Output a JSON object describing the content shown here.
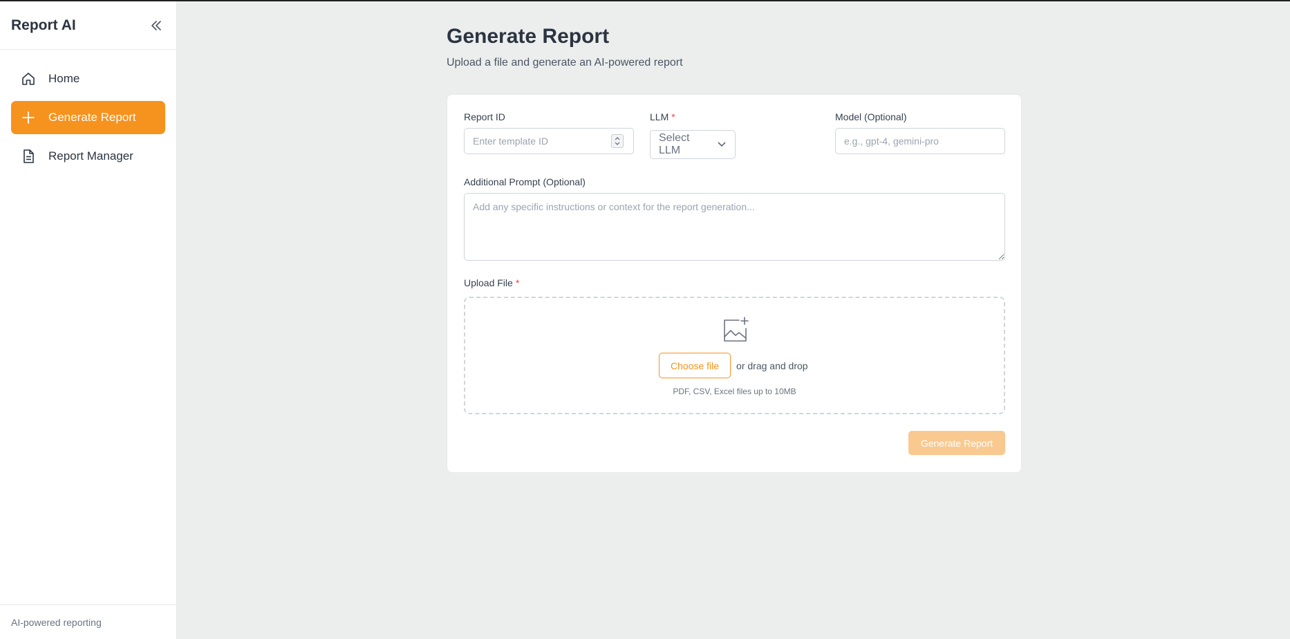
{
  "sidebar": {
    "brand": "Report AI",
    "items": [
      {
        "label": "Home",
        "icon": "home-icon"
      },
      {
        "label": "Generate Report",
        "icon": "plus-icon",
        "active": true
      },
      {
        "label": "Report Manager",
        "icon": "document-icon"
      }
    ],
    "footer": "AI-powered reporting"
  },
  "page": {
    "title": "Generate Report",
    "subtitle": "Upload a file and generate an AI-powered report"
  },
  "form": {
    "report_id": {
      "label": "Report ID",
      "placeholder": "Enter template ID",
      "value": ""
    },
    "llm": {
      "label": "LLM",
      "required_mark": "*",
      "selected": "Select LLM"
    },
    "model": {
      "label": "Model (Optional)",
      "placeholder": "e.g., gpt-4, gemini-pro",
      "value": ""
    },
    "prompt": {
      "label": "Additional Prompt (Optional)",
      "placeholder": "Add any specific instructions or context for the report generation...",
      "value": ""
    },
    "upload": {
      "label": "Upload File",
      "required_mark": "*",
      "choose_label": "Choose file",
      "drag_text": "or drag and drop",
      "hint": "PDF, CSV, Excel files up to 10MB",
      "icon": "image-add-icon"
    },
    "submit_label": "Generate Report",
    "submit_disabled": true
  },
  "colors": {
    "accent": "#f6921e",
    "accent_disabled": "#f9c990",
    "background": "#eceeed",
    "required": "#ef4444"
  }
}
